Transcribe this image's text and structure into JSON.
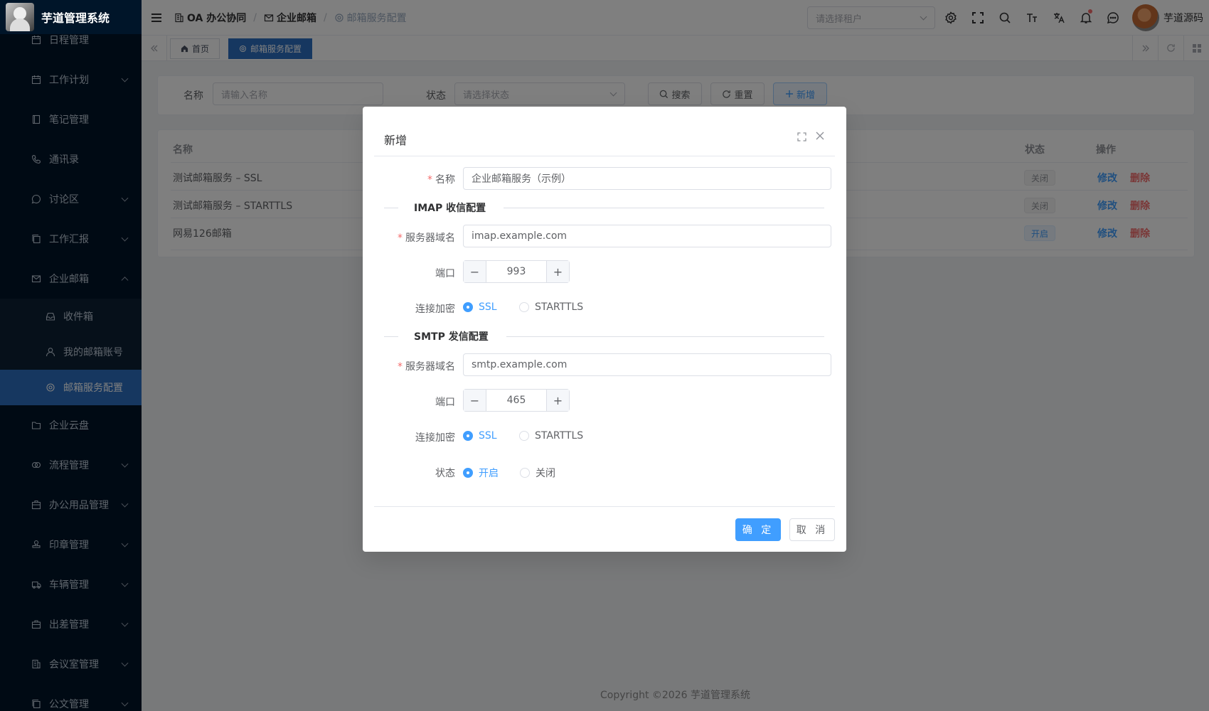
{
  "app": {
    "title": "芋道管理系统"
  },
  "sidebar": {
    "items": [
      {
        "label": "日程管理",
        "icon": "calendar-icon",
        "arrow": ""
      },
      {
        "label": "工作计划",
        "icon": "calendar-icon",
        "arrow": "down"
      },
      {
        "label": "笔记管理",
        "icon": "notebook-icon",
        "arrow": ""
      },
      {
        "label": "通讯录",
        "icon": "phone-icon",
        "arrow": ""
      },
      {
        "label": "讨论区",
        "icon": "chat-icon",
        "arrow": "down"
      },
      {
        "label": "工作汇报",
        "icon": "copy-icon",
        "arrow": "down"
      },
      {
        "label": "企业邮箱",
        "icon": "mail-icon",
        "arrow": "up"
      },
      {
        "label": "收件箱",
        "icon": "inbox-icon",
        "arrow": "",
        "sub": true
      },
      {
        "label": "我的邮箱账号",
        "icon": "user-icon",
        "arrow": "",
        "sub": true
      },
      {
        "label": "邮箱服务配置",
        "icon": "gear-icon",
        "arrow": "",
        "sub": true,
        "active": true
      },
      {
        "label": "企业云盘",
        "icon": "folder-icon",
        "arrow": ""
      },
      {
        "label": "流程管理",
        "icon": "flow-icon",
        "arrow": "down"
      },
      {
        "label": "办公用品管理",
        "icon": "box-icon",
        "arrow": "down"
      },
      {
        "label": "印章管理",
        "icon": "stamp-icon",
        "arrow": "down"
      },
      {
        "label": "车辆管理",
        "icon": "truck-icon",
        "arrow": "down"
      },
      {
        "label": "出差管理",
        "icon": "briefcase-icon",
        "arrow": "down"
      },
      {
        "label": "会议室管理",
        "icon": "building-icon",
        "arrow": "down"
      },
      {
        "label": "公文管理",
        "icon": "copy-icon",
        "arrow": "down"
      }
    ]
  },
  "header": {
    "breadcrumb": [
      "OA 办公协同",
      "企业邮箱",
      "邮箱服务配置"
    ],
    "tenant_placeholder": "请选择租户",
    "user_name": "芋道源码"
  },
  "tags": {
    "home": "首页",
    "current": "邮箱服务配置"
  },
  "search": {
    "name_label": "名称",
    "name_placeholder": "请输入名称",
    "status_label": "状态",
    "status_placeholder": "请选择状态",
    "search_btn": "搜索",
    "reset_btn": "重置",
    "add_btn": "新增"
  },
  "table": {
    "headers": {
      "name": "名称",
      "status": "状态",
      "actions": "操作"
    },
    "rows": [
      {
        "name": "测试邮箱服务 – SSL",
        "status": "关闭",
        "state": "off",
        "edit": "修改",
        "delete": "删除"
      },
      {
        "name": "测试邮箱服务 – STARTTLS",
        "status": "关闭",
        "state": "off",
        "edit": "修改",
        "delete": "删除"
      },
      {
        "name": "网易126邮箱",
        "status": "开启",
        "state": "on",
        "edit": "修改",
        "delete": "删除"
      }
    ]
  },
  "footer": {
    "copyright": "Copyright ©2026 芋道管理系统"
  },
  "dialog": {
    "title": "新增",
    "name_label": "名称",
    "name_value": "企业邮箱服务（示例）",
    "imap_section": "IMAP 收信配置",
    "imap_host_label": "服务器域名",
    "imap_host_value": "imap.example.com",
    "imap_port_label": "端口",
    "imap_port_value": "993",
    "imap_enc_label": "连接加密",
    "smtp_section": "SMTP 发信配置",
    "smtp_host_label": "服务器域名",
    "smtp_host_value": "smtp.example.com",
    "smtp_port_label": "端口",
    "smtp_port_value": "465",
    "smtp_enc_label": "连接加密",
    "enc_ssl": "SSL",
    "enc_starttls": "STARTTLS",
    "status_label": "状态",
    "status_on": "开启",
    "status_off": "关闭",
    "confirm": "确 定",
    "cancel": "取 消"
  },
  "colors": {
    "primary": "#409eff",
    "sidebar_bg": "#001529",
    "sidebar_active": "#2d6fc0",
    "danger": "#f56c6c"
  }
}
